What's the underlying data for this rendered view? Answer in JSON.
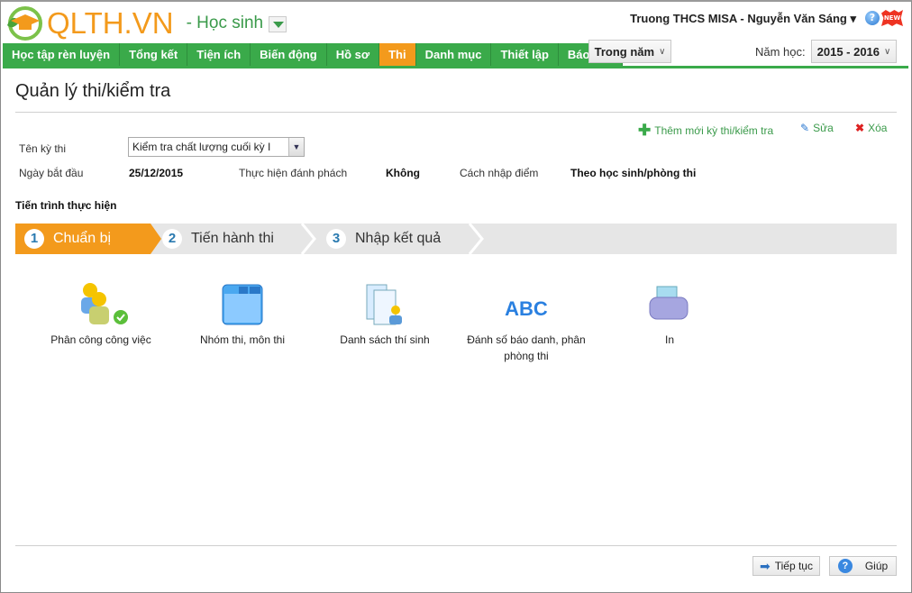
{
  "header": {
    "brand": "QLTH.VN",
    "role": "- Học sinh",
    "user": "Truong THCS MISA - Nguyễn Văn Sáng ▾",
    "help_icon": "?",
    "new_badge": "NEW"
  },
  "nav": {
    "tabs": [
      {
        "label": "Học tập rèn luyện"
      },
      {
        "label": "Tổng kết"
      },
      {
        "label": "Tiện ích"
      },
      {
        "label": "Biến động"
      },
      {
        "label": "Hồ sơ"
      },
      {
        "label": "Thi",
        "active": true
      },
      {
        "label": "Danh mục"
      },
      {
        "label": "Thiết lập"
      },
      {
        "label": "Báo cáo"
      }
    ],
    "period": "Trong năm",
    "year_label": "Năm học:",
    "year": "2015 - 2016"
  },
  "page": {
    "title": "Quản lý thi/kiểm tra",
    "actions": {
      "add": "Thêm mới kỳ thi/kiểm tra",
      "edit": "Sửa",
      "delete": "Xóa"
    }
  },
  "form": {
    "exam_label": "Tên kỳ thi",
    "exam_value": "Kiểm tra chất lượng cuối kỳ I",
    "start_label": "Ngày bắt đầu",
    "start_value": "25/12/2015",
    "sep_label": "Thực hiện đánh phách",
    "sep_value": "Không",
    "input_label": "Cách nhập điểm",
    "input_value": "Theo học sinh/phòng thi"
  },
  "process": {
    "title": "Tiến trình thực hiện",
    "steps": [
      {
        "num": "1",
        "label": "Chuẩn bị"
      },
      {
        "num": "2",
        "label": "Tiến hành thi"
      },
      {
        "num": "3",
        "label": "Nhập kết quả"
      }
    ]
  },
  "features": [
    {
      "label": "Phân công công việc"
    },
    {
      "label": "Nhóm thi, môn thi"
    },
    {
      "label": "Danh sách thí sinh"
    },
    {
      "label": "Đánh số báo danh, phân phòng thi"
    },
    {
      "label": "In"
    }
  ],
  "footer": {
    "next": "Tiếp tục",
    "help": "Giúp"
  },
  "colors": {
    "green": "#3aaa4a",
    "orange": "#f39a1c"
  }
}
